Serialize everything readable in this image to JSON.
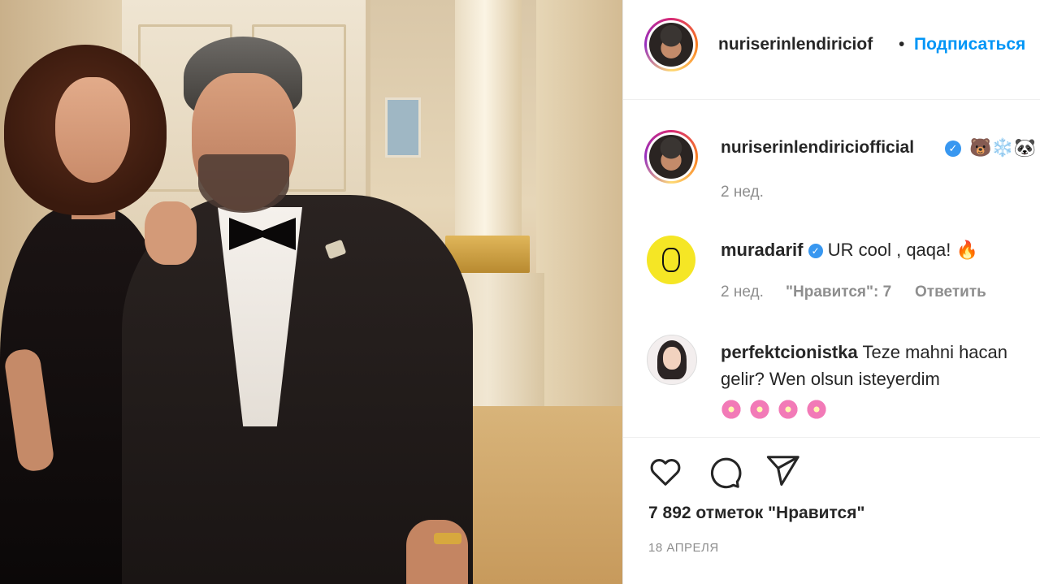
{
  "post": {
    "author": "nuriserinlendiriciof",
    "follow_label": "Подписаться",
    "separator": "•"
  },
  "caption": {
    "author": "nuriserinlendiriciofficial",
    "emoji": "🐻❄️🐼",
    "time": "2 нед."
  },
  "comments": [
    {
      "author": "muradarif",
      "text": "UR cool , qaqa! 🔥",
      "time": "2 нед.",
      "likes": "\"Нравится\": 7",
      "reply": "Ответить",
      "verified": true
    },
    {
      "author": "perfektcionistka",
      "text": "Teze mahni hacan gelir? Wen olsun isteyerdim",
      "emoji_count": 4,
      "verified": false
    }
  ],
  "actions": {
    "like_icon": "heart-icon",
    "comment_icon": "comment-icon",
    "share_icon": "share-icon"
  },
  "stats": {
    "likes_label": "7 892 отметок \"Нравится\"",
    "date": "18 АПРЕЛЯ"
  },
  "colors": {
    "link_blue": "#0095f6",
    "verified_blue": "#3897f0",
    "muted": "#8e8e8e",
    "text": "#262626"
  }
}
